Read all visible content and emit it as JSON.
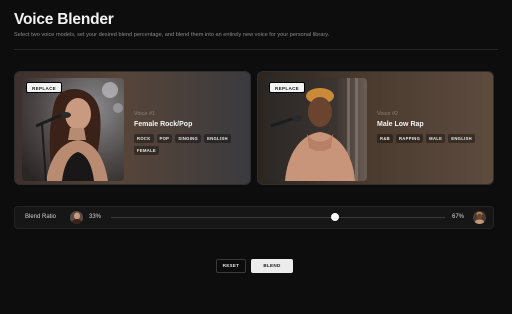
{
  "header": {
    "title": "Voice Blender",
    "subtitle": "Select two voice models, set your desired blend percentage, and blend them into an entirely new voice for your personal library."
  },
  "voices": [
    {
      "replace_label": "REPLACE",
      "number_label": "Voice #1",
      "name": "Female Rock/Pop",
      "tags": [
        "ROCK",
        "POP",
        "SINGING",
        "ENGLISH",
        "FEMALE"
      ],
      "photo": "singer-woman-with-microphone"
    },
    {
      "replace_label": "REPLACE",
      "number_label": "Voice #2",
      "name": "Male Low Rap",
      "tags": [
        "R&B",
        "RAPPING",
        "MALE",
        "ENGLISH"
      ],
      "photo": "rapper-man-with-microphone"
    }
  ],
  "blend": {
    "label": "Blend Ratio",
    "left_percent": "33%",
    "right_percent": "67%",
    "ratio": 0.67
  },
  "actions": {
    "reset_label": "RESET",
    "blend_label": "BLEND"
  },
  "colors": {
    "background": "#0d0d0d",
    "accent": "#ececec"
  }
}
